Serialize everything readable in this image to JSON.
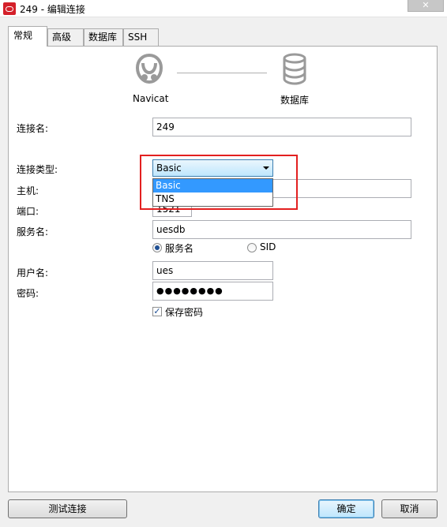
{
  "window": {
    "title": "249 - 编辑连接",
    "close_glyph": "✕"
  },
  "tabs": [
    {
      "label": "常规"
    },
    {
      "label": "高级"
    },
    {
      "label": "数据库"
    },
    {
      "label": "SSH"
    }
  ],
  "header": {
    "left_label": "Navicat",
    "right_label": "数据库",
    "left_icon": "navicat-icon",
    "right_icon": "database-icon"
  },
  "form": {
    "connection_name_label": "连接名:",
    "connection_name_value": "249",
    "connection_type_label": "连接类型:",
    "connection_type_value": "Basic",
    "connection_type_options": [
      "Basic",
      "TNS"
    ],
    "host_label": "主机:",
    "port_label": "端口:",
    "port_value": "1521",
    "service_name_label": "服务名:",
    "service_name_value": "uesdb",
    "radio_service_name": "服务名",
    "radio_sid": "SID",
    "username_label": "用户名:",
    "username_value": "ues",
    "password_label": "密码:",
    "password_value": "●●●●●●●●",
    "save_password_label": "保存密码",
    "check_mark": "✓"
  },
  "buttons": {
    "test": "测试连接",
    "ok": "确定",
    "cancel": "取消"
  },
  "colors": {
    "highlight": "#e32020",
    "selected": "#3399ff"
  }
}
